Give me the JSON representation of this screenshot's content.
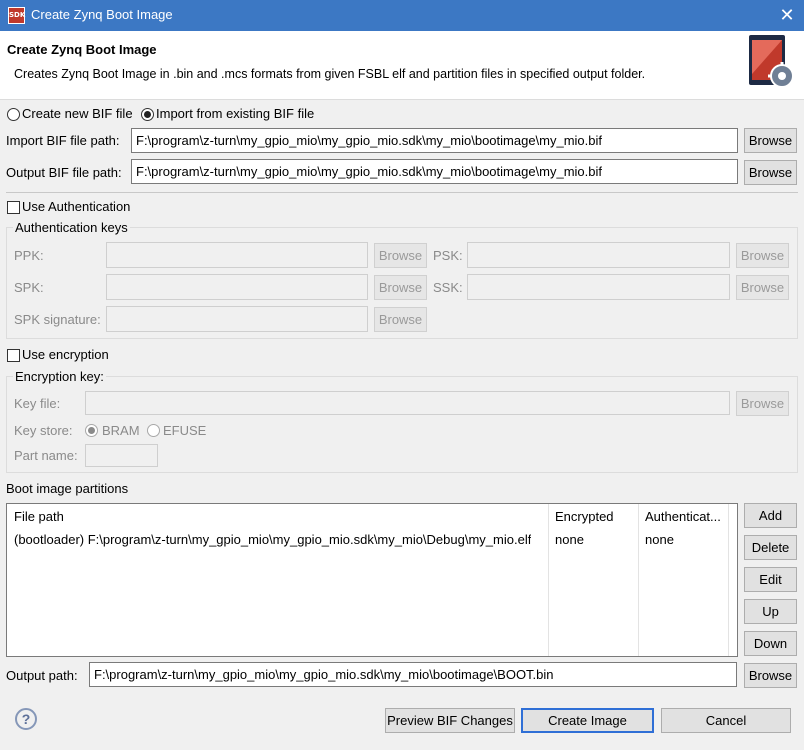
{
  "window": {
    "title": "Create Zynq Boot Image",
    "app_icon_text": "SDK"
  },
  "header": {
    "title": "Create Zynq Boot Image",
    "description": "Creates Zynq Boot Image in .bin and .mcs formats from given FSBL elf and partition files in specified output folder."
  },
  "bif_mode": {
    "create_new_label": "Create new BIF file",
    "import_label": "Import from existing BIF file",
    "selected": "import"
  },
  "import_bif": {
    "label": "Import BIF file path:",
    "value": "F:\\program\\z-turn\\my_gpio_mio\\my_gpio_mio.sdk\\my_mio\\bootimage\\my_mio.bif",
    "browse": "Browse"
  },
  "output_bif": {
    "label": "Output BIF file path:",
    "value": "F:\\program\\z-turn\\my_gpio_mio\\my_gpio_mio.sdk\\my_mio\\bootimage\\my_mio.bif",
    "browse": "Browse"
  },
  "authentication": {
    "checkbox_label": "Use Authentication",
    "checked": false,
    "group_title": "Authentication keys",
    "ppk_label": "PPK:",
    "psk_label": "PSK:",
    "spk_label": "SPK:",
    "ssk_label": "SSK:",
    "spk_signature_label": "SPK signature:",
    "browse": "Browse"
  },
  "encryption": {
    "checkbox_label": "Use encryption",
    "checked": false,
    "group_title": "Encryption key:",
    "key_file_label": "Key file:",
    "key_store_label": "Key store:",
    "bram_label": "BRAM",
    "efuse_label": "EFUSE",
    "key_store_selected": "BRAM",
    "part_name_label": "Part name:",
    "browse": "Browse"
  },
  "partitions": {
    "section_label": "Boot image partitions",
    "columns": [
      "File path",
      "Encrypted",
      "Authenticat..."
    ],
    "rows": [
      {
        "file_path": "(bootloader) F:\\program\\z-turn\\my_gpio_mio\\my_gpio_mio.sdk\\my_mio\\Debug\\my_mio.elf",
        "encrypted": "none",
        "authenticated": "none"
      }
    ],
    "buttons": {
      "add": "Add",
      "delete": "Delete",
      "edit": "Edit",
      "up": "Up",
      "down": "Down"
    }
  },
  "output_path": {
    "label": "Output path:",
    "value": "F:\\program\\z-turn\\my_gpio_mio\\my_gpio_mio.sdk\\my_mio\\bootimage\\BOOT.bin",
    "browse": "Browse"
  },
  "footer": {
    "preview_label": "Preview BIF Changes",
    "create_label": "Create Image",
    "cancel_label": "Cancel",
    "help_icon_glyph": "?"
  },
  "colors": {
    "titlebar": "#3c78c4",
    "primary_button_border": "#2f6fd6"
  }
}
